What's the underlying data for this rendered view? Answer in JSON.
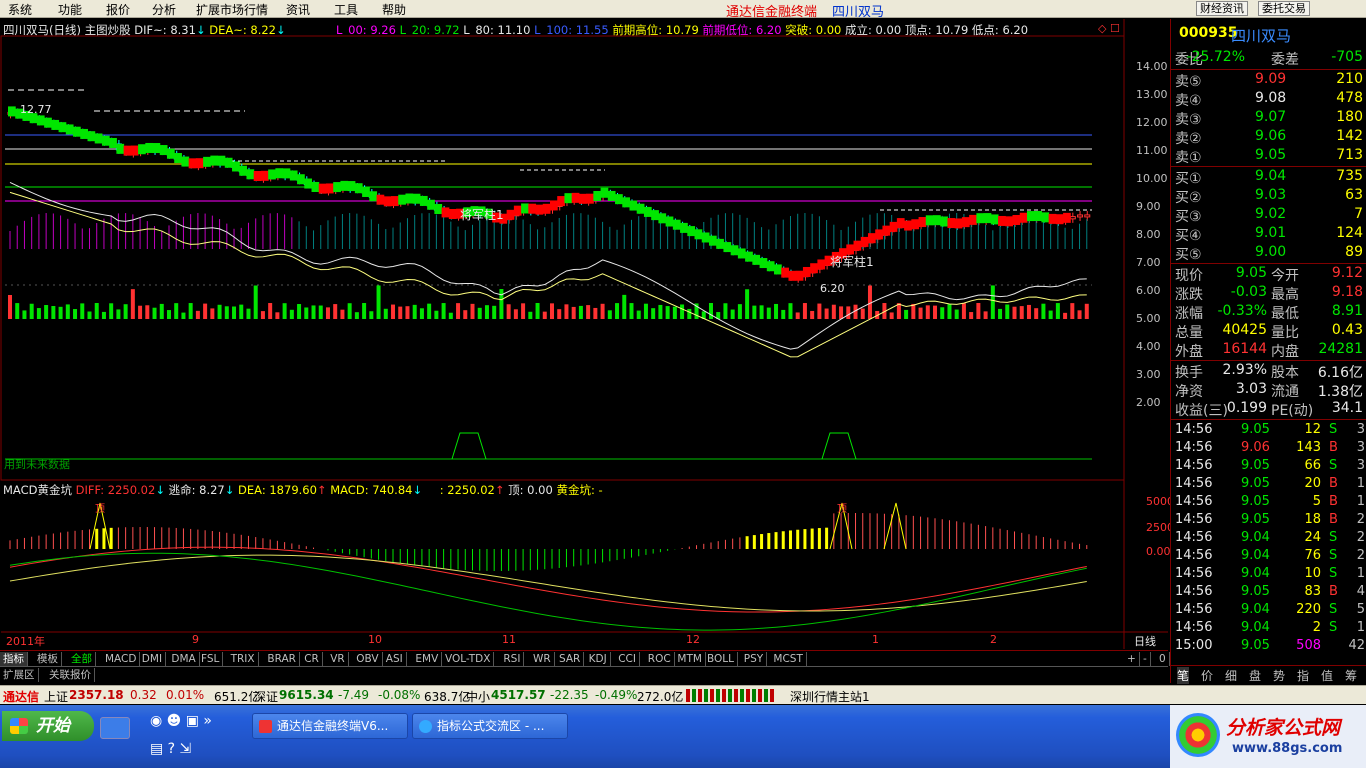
{
  "menu": {
    "items": [
      "系统",
      "功能",
      "报价",
      "分析",
      "扩展市场行情",
      "资讯",
      "工具",
      "帮助"
    ],
    "app_title": "通达信金融终端",
    "stock_title": "四川双马",
    "btn_news": "财经资讯",
    "btn_order": "委托交易"
  },
  "main_title": {
    "name": "四川双马(日线)",
    "formula": "主图炒股",
    "dif": "DIF~: 8.31",
    "dea": "DEA~: 8.22",
    "l00": "L_00: 9.26",
    "l20": "L_20: 9.72",
    "l80": "L_80: 11.10",
    "l100": "L_100: 11.55",
    "prev_high": "前期高位: 10.79",
    "prev_low": "前期低位: 6.20",
    "breakout": "突破: 0.00",
    "done": "成立: 0.00",
    "top_point": "顶点: 10.79",
    "low_point": "低点: 6.20"
  },
  "main_axis": [
    "14.00",
    "13.00",
    "12.00",
    "11.00",
    "10.00",
    "9.00",
    "8.00",
    "7.00",
    "6.00",
    "5.00",
    "4.00",
    "3.00",
    "2.00"
  ],
  "annotations": {
    "price_high": "12.77",
    "price_low": "6.20",
    "signal": "将军柱1",
    "signal2": "将军柱1",
    "future": "用到未来数据"
  },
  "macd_title": {
    "name": "MACD黄金坑",
    "diff": "DIFF: 2250.02",
    "escape": "逃命: 8.27",
    "dea": "DEA: 1879.60",
    "macd": "MACD: 740.84",
    "val": ": 2250.02",
    "top": "顶: 0.00",
    "pit": "黄金坑: -"
  },
  "macd_axis": [
    "5000",
    "2500",
    "0.00"
  ],
  "macd_marks": {
    "top": "顶"
  },
  "date_axis": {
    "year": "2011年",
    "months": [
      "9",
      "10",
      "11",
      "12",
      "1",
      "2"
    ],
    "period": "日线"
  },
  "tabs": [
    "指标",
    "模板",
    "全部",
    "MACD",
    "DMI",
    "DMA",
    "FSL",
    "TRIX",
    "BRAR",
    "CR",
    "VR",
    "OBV",
    "ASI",
    "EMV",
    "VOL-TDX",
    "RSI",
    "WR",
    "SAR",
    "KDJ",
    "CCI",
    "ROC",
    "MTM",
    "BOLL",
    "PSY",
    "MCST"
  ],
  "ext_tabs": [
    "扩展区",
    "关联报价"
  ],
  "zoom_ctrl": [
    "+",
    "-",
    "0"
  ],
  "quote": {
    "code": "000935",
    "name": "四川双马",
    "weibi_label": "委比",
    "weibi": "-25.72%",
    "weicha_label": "委差",
    "weicha": "-705",
    "asks": [
      {
        "label": "卖⑤",
        "price": "9.09",
        "vol": "210"
      },
      {
        "label": "卖④",
        "price": "9.08",
        "vol": "478"
      },
      {
        "label": "卖③",
        "price": "9.07",
        "vol": "180"
      },
      {
        "label": "卖②",
        "price": "9.06",
        "vol": "142"
      },
      {
        "label": "卖①",
        "price": "9.05",
        "vol": "713"
      }
    ],
    "bids": [
      {
        "label": "买①",
        "price": "9.04",
        "vol": "735"
      },
      {
        "label": "买②",
        "price": "9.03",
        "vol": "63"
      },
      {
        "label": "买③",
        "price": "9.02",
        "vol": "7"
      },
      {
        "label": "买④",
        "price": "9.01",
        "vol": "124"
      },
      {
        "label": "买⑤",
        "price": "9.00",
        "vol": "89"
      }
    ],
    "stats": [
      {
        "l1": "现价",
        "v1": "9.05",
        "l2": "今开",
        "v2": "9.12"
      },
      {
        "l1": "涨跌",
        "v1": "-0.03",
        "l2": "最高",
        "v2": "9.18"
      },
      {
        "l1": "涨幅",
        "v1": "-0.33%",
        "l2": "最低",
        "v2": "8.91"
      },
      {
        "l1": "总量",
        "v1": "40425",
        "l2": "量比",
        "v2": "0.43"
      },
      {
        "l1": "外盘",
        "v1": "16144",
        "l2": "内盘",
        "v2": "24281"
      }
    ],
    "stats2": [
      {
        "l1": "换手",
        "v1": "2.93%",
        "l2": "股本",
        "v2": "6.16亿"
      },
      {
        "l1": "净资",
        "v1": "3.03",
        "l2": "流通",
        "v2": "1.38亿"
      },
      {
        "l1": "收益(三)",
        "v1": "0.199",
        "l2": "PE(动)",
        "v2": "34.1"
      }
    ],
    "ticks": [
      {
        "t": "14:56",
        "p": "9.05",
        "v": "12",
        "s": "S",
        "n": "3"
      },
      {
        "t": "14:56",
        "p": "9.06",
        "v": "143",
        "s": "B",
        "n": "3"
      },
      {
        "t": "14:56",
        "p": "9.05",
        "v": "66",
        "s": "S",
        "n": "3"
      },
      {
        "t": "14:56",
        "p": "9.05",
        "v": "20",
        "s": "B",
        "n": "1"
      },
      {
        "t": "14:56",
        "p": "9.05",
        "v": "5",
        "s": "B",
        "n": "1"
      },
      {
        "t": "14:56",
        "p": "9.05",
        "v": "18",
        "s": "B",
        "n": "2"
      },
      {
        "t": "14:56",
        "p": "9.04",
        "v": "24",
        "s": "S",
        "n": "2"
      },
      {
        "t": "14:56",
        "p": "9.04",
        "v": "76",
        "s": "S",
        "n": "2"
      },
      {
        "t": "14:56",
        "p": "9.04",
        "v": "10",
        "s": "S",
        "n": "1"
      },
      {
        "t": "14:56",
        "p": "9.05",
        "v": "83",
        "s": "B",
        "n": "4"
      },
      {
        "t": "14:56",
        "p": "9.04",
        "v": "220",
        "s": "S",
        "n": "5"
      },
      {
        "t": "14:56",
        "p": "9.04",
        "v": "2",
        "s": "S",
        "n": "1"
      },
      {
        "t": "15:00",
        "p": "9.05",
        "v": "508",
        "s": "",
        "n": "42"
      }
    ],
    "bottom_tabs": [
      "笔",
      "价",
      "细",
      "盘",
      "势",
      "指",
      "值",
      "筹"
    ]
  },
  "status": {
    "brand": "通达信",
    "sh_label": "上证",
    "sh_val": "2357.18",
    "sh_chg": "0.32",
    "sh_pct": "0.01%",
    "sh_amt": "651.2亿",
    "sz_label": "深证",
    "sz_val": "9615.34",
    "sz_chg": "-7.49",
    "sz_pct": "-0.08%",
    "sz_amt": "638.7亿",
    "zx_label": "中小",
    "zx_val": "4517.57",
    "zx_chg": "-22.35",
    "zx_pct": "-0.49%",
    "zx_amt": "272.0亿",
    "server": "深圳行情主站1"
  },
  "taskbar": {
    "start": "开始",
    "task1": "通达信金融终端V6...",
    "task2": "指标公式交流区 - ...",
    "logo": "分析家公式网",
    "logo_url_text": "www.88gs.com"
  },
  "colors": {
    "up": "#ff3232",
    "down": "#00e600",
    "flat": "#e8e8e8",
    "frame": "#800000",
    "yellow": "#ffff00"
  }
}
